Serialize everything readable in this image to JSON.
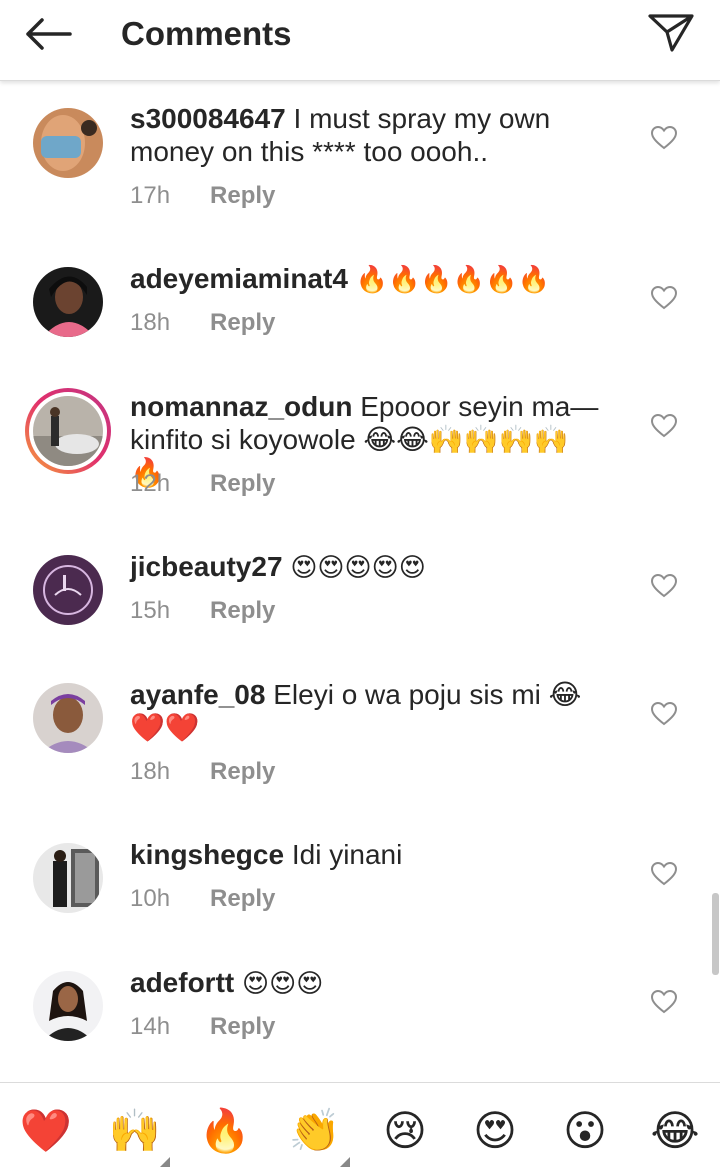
{
  "header": {
    "title": "Comments"
  },
  "comments": [
    {
      "user": "s300084647",
      "text": "I must spray my own money on this **** too oooh..",
      "time": "17h",
      "reply": "Reply"
    },
    {
      "user": "adeyemiaminat4",
      "text": "🔥🔥🔥🔥🔥🔥",
      "time": "18h",
      "reply": "Reply"
    },
    {
      "user": "nomannaz_odun",
      "text": "Epooor seyin ma—kinfito si koyowole 😂😂🙌🙌🙌🙌🔥",
      "time": "12h",
      "reply": "Reply"
    },
    {
      "user": "jicbeauty27",
      "text": "😍😍😍😍😍",
      "time": "15h",
      "reply": "Reply"
    },
    {
      "user": "ayanfe_08",
      "text": "Eleyi o wa poju sis mi 😂❤️❤️",
      "time": "18h",
      "reply": "Reply"
    },
    {
      "user": "kingshegce",
      "text": "Idi yinani",
      "time": "10h",
      "reply": "Reply"
    },
    {
      "user": "adefortt",
      "text": "😍😍😍",
      "time": "14h",
      "reply": "Reply"
    }
  ],
  "quick_emojis": [
    "❤️",
    "🙌",
    "🔥",
    "👏",
    "😢",
    "😍",
    "😮",
    "😂"
  ]
}
